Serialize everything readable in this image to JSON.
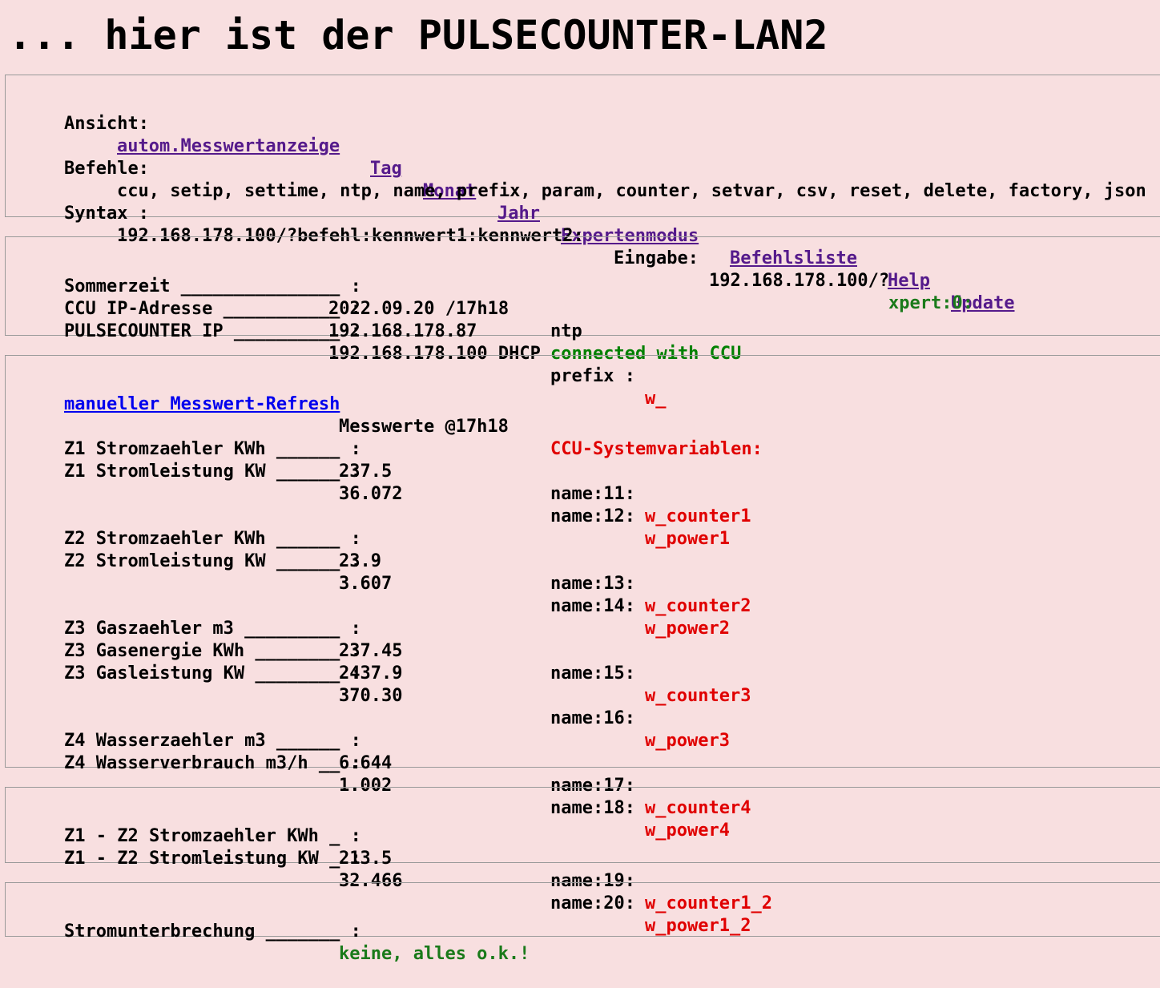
{
  "title": "... hier ist der PULSECOUNTER-LAN2",
  "nav": {
    "label": "Ansicht:",
    "links": [
      "autom.Messwertanzeige",
      "Tag",
      "Monat",
      "Jahr",
      "Expertenmodus",
      "Befehlsliste",
      "Help",
      "Update"
    ]
  },
  "commands": {
    "label": "Befehle:",
    "list": "ccu, setip, settime, ntp, name, prefix, param, counter, setvar, csv, reset, delete, factory, json"
  },
  "syntax": {
    "label": "Syntax :",
    "pattern": "192.168.178.100/?befehl:kennwert1:kennwert2:",
    "input_label": "Eingabe:",
    "input_prefix": "192.168.178.100/?",
    "input_value": "xpert:0:"
  },
  "status": {
    "summer_label": "Sommerzeit _______________ :",
    "summer_value": "2022.09.20 /17h18",
    "summer_source": "ntp",
    "ccu_label": "CCU IP-Adresse ___________ :",
    "ccu_value": "192.168.178.87",
    "ccu_status": "connected with CCU",
    "pc_label": "PULSECOUNTER IP __________ :",
    "pc_value": "192.168.178.100 DHCP",
    "prefix_label": "prefix :",
    "prefix_value": "w_"
  },
  "measurements": {
    "refresh_link": "manueller Messwert-Refresh",
    "time_label": "Messwerte @17h18",
    "sysvar_header": "CCU-Systemvariablen:",
    "rows": [
      {
        "label": "Z1 Stromzaehler KWh ______ :",
        "value": "237.5",
        "name_label": "name:11:",
        "var": "w_counter1"
      },
      {
        "label": "Z1 Stromleistung KW ______ :",
        "value": "36.072",
        "name_label": "name:12:",
        "var": "w_power1"
      },
      {
        "label": "Z2 Stromzaehler KWh ______ :",
        "value": "23.9",
        "name_label": "name:13:",
        "var": "w_counter2"
      },
      {
        "label": "Z2 Stromleistung KW ______ :",
        "value": "3.607",
        "name_label": "name:14:",
        "var": "w_power2"
      },
      {
        "label": "Z3 Gaszaehler m3 _________ :",
        "value": "237.45",
        "name_label": "name:15:",
        "var": "w_counter3"
      },
      {
        "label": "Z3 Gasenergie KWh ________ :",
        "value": "2437.9",
        "name_label": "",
        "var": ""
      },
      {
        "label": "Z3 Gasleistung KW ________ :",
        "value": "370.30",
        "name_label": "name:16:",
        "var": "w_power3"
      },
      {
        "label": "Z4 Wasserzaehler m3 ______ :",
        "value": "6.644",
        "name_label": "name:17:",
        "var": "w_counter4"
      },
      {
        "label": "Z4 Wasserverbrauch m3/h __ :",
        "value": "1.002",
        "name_label": "name:18:",
        "var": "w_power4"
      }
    ]
  },
  "diff": {
    "rows": [
      {
        "label": "Z1 - Z2 Stromzaehler KWh _ :",
        "value": "213.5",
        "name_label": "name:19:",
        "var": "w_counter1_2"
      },
      {
        "label": "Z1 - Z2 Stromleistung KW _ :",
        "value": "32.466",
        "name_label": "name:20:",
        "var": "w_power1_2"
      }
    ]
  },
  "power_outage": {
    "label": "Stromunterbrechung _______ :",
    "value": "keine, alles o.k.!"
  }
}
